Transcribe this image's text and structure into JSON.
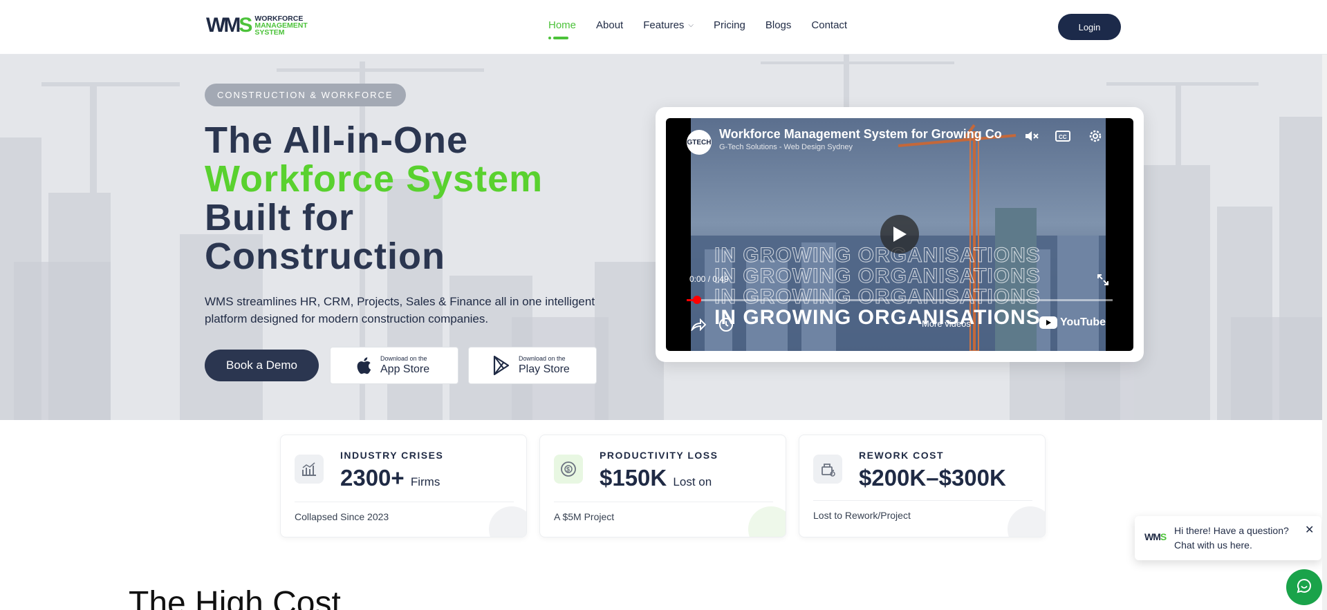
{
  "header": {
    "logo": {
      "mark_primary": "WM",
      "mark_accent": "S",
      "line1": "WORKFORCE",
      "line2": "MANAGEMENT",
      "line3": "SYSTEM"
    },
    "nav": [
      {
        "label": "Home",
        "active": true
      },
      {
        "label": "About"
      },
      {
        "label": "Features",
        "has_dropdown": true
      },
      {
        "label": "Pricing"
      },
      {
        "label": "Blogs"
      },
      {
        "label": "Contact"
      }
    ],
    "login_label": "Login"
  },
  "hero": {
    "badge": "CONSTRUCTION & WORKFORCE",
    "title_line1": "The All-in-One",
    "title_line2": "Workforce System",
    "title_line3": "Built for Construction",
    "description": "WMS streamlines HR, CRM, Projects, Sales & Finance all in one intelligent platform designed for modern construction companies.",
    "demo_button": "Book a Demo",
    "app_store": {
      "small": "Download on the",
      "big": "App Store",
      "icon": "apple-icon"
    },
    "play_store": {
      "small": "Download on the",
      "big": "Play Store",
      "icon": "google-play-icon"
    }
  },
  "video": {
    "title": "Workforce Management System for Growing Co",
    "channel": "G-Tech Solutions - Web Design Sydney",
    "avatar_text": "GTECH",
    "time": "0:00 / 0:49",
    "progress": 0.0,
    "overlay_text": "IN GROWING ORGANISATIONS",
    "more_videos": "More videos",
    "brand": "YouTube"
  },
  "stats": [
    {
      "label": "INDUSTRY CRISES",
      "value": "2300+",
      "suffix": "Firms",
      "sub": "Collapsed Since 2023",
      "icon": "chart-icon",
      "accent": "gray"
    },
    {
      "label": "PRODUCTIVITY LOSS",
      "value": "$150K",
      "suffix": "Lost on",
      "sub": "A $5M Project",
      "icon": "money-icon",
      "accent": "green"
    },
    {
      "label": "REWORK COST",
      "value": "$200K–$300K",
      "suffix": "",
      "sub": "Lost to Rework/Project",
      "icon": "rework-icon",
      "accent": "gray"
    }
  ],
  "section_title": "The High Cost",
  "chat": {
    "message": "Hi there! Have a question? Chat with us here.",
    "close": "✕",
    "logo_primary": "WM",
    "logo_accent": "S"
  },
  "colors": {
    "brand_navy": "#1c2a4a",
    "brand_green": "#4cc23a",
    "title_green": "#59d12f",
    "chat_green": "#1aa34a"
  }
}
